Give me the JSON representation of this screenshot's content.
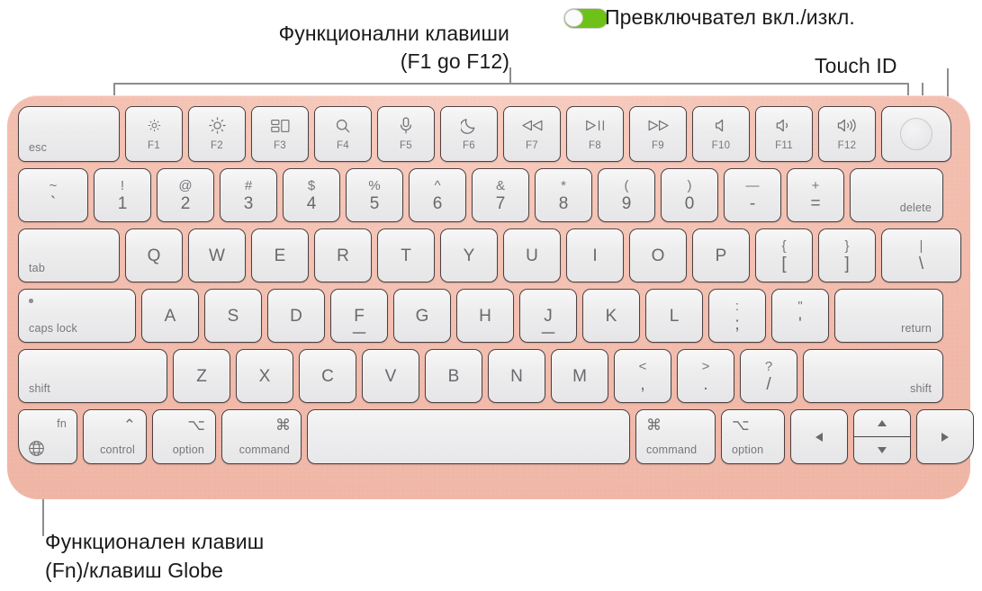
{
  "annotations": {
    "function_keys_label": "Функционални клавиши\n(F1 go F12)",
    "power_toggle_label": "Превключвател вкл./изкл.",
    "touch_id_label": "Touch ID",
    "fn_globe_label": "Функционален клавиш\n(Fn)/клавиш Globe"
  },
  "colors": {
    "body": "#f1b9a9",
    "key_face": "#ededee",
    "key_border": "#4a4142",
    "legend": "#6a6a6c",
    "toggle_on": "#6ec116",
    "leader_line": "#8d8d8d"
  },
  "keyboard": {
    "device": "Magic Keyboard with Touch ID",
    "rows": {
      "function_row": [
        {
          "name": "esc",
          "label": "esc",
          "icon": null
        },
        {
          "name": "f1",
          "fkey": "F1",
          "icon": "brightness-down-icon"
        },
        {
          "name": "f2",
          "fkey": "F2",
          "icon": "brightness-up-icon"
        },
        {
          "name": "f3",
          "fkey": "F3",
          "icon": "mission-control-icon"
        },
        {
          "name": "f4",
          "fkey": "F4",
          "icon": "spotlight-search-icon"
        },
        {
          "name": "f5",
          "fkey": "F5",
          "icon": "dictation-microphone-icon"
        },
        {
          "name": "f6",
          "fkey": "F6",
          "icon": "do-not-disturb-moon-icon"
        },
        {
          "name": "f7",
          "fkey": "F7",
          "icon": "rewind-icon"
        },
        {
          "name": "f8",
          "fkey": "F8",
          "icon": "play-pause-icon"
        },
        {
          "name": "f9",
          "fkey": "F9",
          "icon": "fast-forward-icon"
        },
        {
          "name": "f10",
          "fkey": "F10",
          "icon": "volume-mute-icon"
        },
        {
          "name": "f11",
          "fkey": "F11",
          "icon": "volume-down-icon"
        },
        {
          "name": "f12",
          "fkey": "F12",
          "icon": "volume-up-icon"
        },
        {
          "name": "touch-id",
          "icon": "touch-id-icon"
        }
      ],
      "number_row": [
        {
          "name": "grave",
          "upper": "~",
          "lower": "`"
        },
        {
          "name": "1",
          "upper": "!",
          "lower": "1"
        },
        {
          "name": "2",
          "upper": "@",
          "lower": "2"
        },
        {
          "name": "3",
          "upper": "#",
          "lower": "3"
        },
        {
          "name": "4",
          "upper": "$",
          "lower": "4"
        },
        {
          "name": "5",
          "upper": "%",
          "lower": "5"
        },
        {
          "name": "6",
          "upper": "^",
          "lower": "6"
        },
        {
          "name": "7",
          "upper": "&",
          "lower": "7"
        },
        {
          "name": "8",
          "upper": "*",
          "lower": "8"
        },
        {
          "name": "9",
          "upper": "(",
          "lower": "9"
        },
        {
          "name": "0",
          "upper": ")",
          "lower": "0"
        },
        {
          "name": "minus",
          "upper": "—",
          "lower": "-"
        },
        {
          "name": "equal",
          "upper": "+",
          "lower": "="
        },
        {
          "name": "delete",
          "label": "delete"
        }
      ],
      "qwerty_row": [
        {
          "name": "tab",
          "label": "tab"
        },
        {
          "name": "q",
          "glyph": "Q"
        },
        {
          "name": "w",
          "glyph": "W"
        },
        {
          "name": "e",
          "glyph": "E"
        },
        {
          "name": "r",
          "glyph": "R"
        },
        {
          "name": "t",
          "glyph": "T"
        },
        {
          "name": "y",
          "glyph": "Y"
        },
        {
          "name": "u",
          "glyph": "U"
        },
        {
          "name": "i",
          "glyph": "I"
        },
        {
          "name": "o",
          "glyph": "O"
        },
        {
          "name": "p",
          "glyph": "P"
        },
        {
          "name": "bracket-left",
          "upper": "{",
          "lower": "["
        },
        {
          "name": "bracket-right",
          "upper": "}",
          "lower": "]"
        },
        {
          "name": "backslash",
          "upper": "|",
          "lower": "\\"
        }
      ],
      "home_row": [
        {
          "name": "caps-lock",
          "label": "caps lock"
        },
        {
          "name": "a",
          "glyph": "A"
        },
        {
          "name": "s",
          "glyph": "S"
        },
        {
          "name": "d",
          "glyph": "D"
        },
        {
          "name": "f",
          "glyph": "F"
        },
        {
          "name": "g",
          "glyph": "G"
        },
        {
          "name": "h",
          "glyph": "H"
        },
        {
          "name": "j",
          "glyph": "J"
        },
        {
          "name": "k",
          "glyph": "K"
        },
        {
          "name": "l",
          "glyph": "L"
        },
        {
          "name": "semicolon",
          "upper": ":",
          "lower": ";"
        },
        {
          "name": "quote",
          "upper": "\"",
          "lower": "'"
        },
        {
          "name": "return",
          "label": "return"
        }
      ],
      "shift_row": [
        {
          "name": "shift-left",
          "label": "shift"
        },
        {
          "name": "z",
          "glyph": "Z"
        },
        {
          "name": "x",
          "glyph": "X"
        },
        {
          "name": "c",
          "glyph": "C"
        },
        {
          "name": "v",
          "glyph": "V"
        },
        {
          "name": "b",
          "glyph": "B"
        },
        {
          "name": "n",
          "glyph": "N"
        },
        {
          "name": "m",
          "glyph": "M"
        },
        {
          "name": "comma",
          "upper": "<",
          "lower": ","
        },
        {
          "name": "period",
          "upper": ">",
          "lower": "."
        },
        {
          "name": "slash",
          "upper": "?",
          "lower": "/"
        },
        {
          "name": "shift-right",
          "label": "shift"
        }
      ],
      "bottom_row": [
        {
          "name": "fn-globe",
          "label": "fn",
          "icon": "globe-icon"
        },
        {
          "name": "control",
          "label": "control",
          "symbol": "⌃"
        },
        {
          "name": "option-left",
          "label": "option",
          "symbol": "⌥"
        },
        {
          "name": "command-left",
          "label": "command",
          "symbol": "⌘"
        },
        {
          "name": "space",
          "label": ""
        },
        {
          "name": "command-right",
          "label": "command",
          "symbol": "⌘"
        },
        {
          "name": "option-right",
          "label": "option",
          "symbol": "⌥"
        },
        {
          "name": "arrow-left",
          "icon": "arrow-left-icon"
        },
        {
          "name": "arrow-up-down",
          "icon": "arrow-up-down-icon"
        },
        {
          "name": "arrow-right",
          "icon": "arrow-right-icon"
        }
      ]
    }
  }
}
